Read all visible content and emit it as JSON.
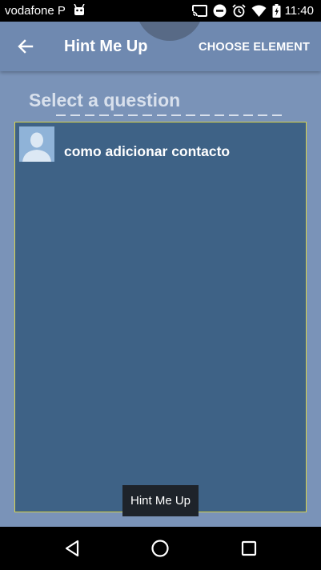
{
  "status_bar": {
    "carrier": "vodafone P",
    "time": "11:40",
    "icons": [
      "android-icon",
      "cast-icon",
      "do-not-disturb-icon",
      "alarm-icon",
      "wifi-icon",
      "battery-icon"
    ]
  },
  "app_bar": {
    "title": "Hint Me Up",
    "action": "CHOOSE ELEMENT",
    "back_icon": "arrow-back-icon"
  },
  "content": {
    "heading": "Select a question",
    "questions": [
      {
        "label": "como adicionar contacto",
        "icon": "default-avatar-icon"
      }
    ]
  },
  "toast": {
    "text": "Hint Me Up"
  },
  "nav_bar": {
    "buttons": [
      "back-triangle-icon",
      "home-circle-icon",
      "recents-square-icon"
    ]
  },
  "colors": {
    "background": "#7a93b8",
    "app_bar": "#6f89b0",
    "panel": "#3e6286",
    "panel_border": "#d8d24a",
    "heading": "#d8e0ec"
  }
}
